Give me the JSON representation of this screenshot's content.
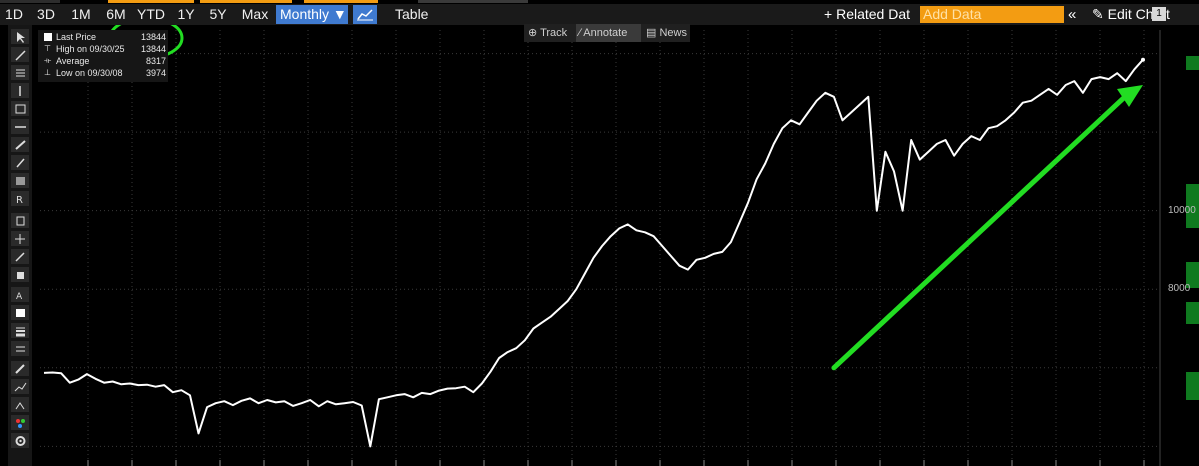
{
  "toolbar": {
    "range_buttons": [
      "1D",
      "3D",
      "1M",
      "6M",
      "YTD",
      "1Y",
      "5Y",
      "Max"
    ],
    "frequency": "Monthly",
    "table_label": "Table",
    "related_label": "Related Dat",
    "add_data_placeholder": "Add Data",
    "collapse_glyph": "«",
    "edit_chart_label": "Edit Chart",
    "badge_label": "1"
  },
  "chart_tabs": [
    "Track",
    "Annotate",
    "News"
  ],
  "legend": {
    "rows": [
      {
        "label": "Last Price",
        "value": "13844"
      },
      {
        "label": "High on 09/30/25",
        "value": "13844"
      },
      {
        "label": "Average",
        "value": "8317"
      },
      {
        "label": "Low on 09/30/08",
        "value": "3974"
      }
    ]
  },
  "colors": {
    "background": "#000000",
    "line": "#ffffff",
    "highlight": "#22dd22",
    "accent_blue": "#3f7ad0",
    "add_data_orange": "#f39c12"
  },
  "chart_data": {
    "type": "line",
    "series": [
      {
        "name": "Last Price",
        "values": [
          5870,
          5880,
          5860,
          5620,
          5700,
          5840,
          5720,
          5620,
          5650,
          5580,
          5600,
          5560,
          5570,
          5520,
          5560,
          5380,
          5430,
          5300,
          4330,
          5000,
          5100,
          5150,
          5050,
          5160,
          5220,
          5100,
          5180,
          5120,
          5150,
          5030,
          5100,
          5180,
          5020,
          5150,
          5070,
          5100,
          5130,
          5040,
          4000,
          5200,
          5250,
          5300,
          5330,
          5250,
          5360,
          5330,
          5420,
          5470,
          5480,
          5520,
          5380,
          5600,
          5900,
          6250,
          6400,
          6500,
          6700,
          7000,
          7150,
          7300,
          7500,
          7700,
          8000,
          8400,
          8800,
          9100,
          9350,
          9550,
          9650,
          9500,
          9450,
          9350,
          9100,
          8850,
          8600,
          8500,
          8750,
          8800,
          8900,
          8950,
          9200,
          9700,
          10200,
          10800,
          11200,
          11700,
          12100,
          12300,
          12200,
          12500,
          12800,
          13000,
          12900,
          12300,
          12500,
          12700,
          12900,
          10000,
          11500,
          11000,
          10000,
          11800,
          11300,
          11500,
          11700,
          11800,
          11400,
          11700,
          11900,
          11800,
          12100,
          12150,
          12300,
          12500,
          12750,
          12800,
          12950,
          13100,
          12950,
          13200,
          13300,
          13000,
          13350,
          13400,
          13350,
          13500,
          13300,
          13600,
          13844
        ]
      }
    ],
    "ylim": [
      3500,
      14600
    ],
    "ytick_labels": [
      "10000",
      "8000"
    ],
    "grid": true,
    "legend_position": "top-left",
    "annotations": [
      {
        "type": "arrow",
        "color": "#22dd22",
        "from_index": 92,
        "from_value": 6000,
        "to_index": 128,
        "to_value": 13200
      },
      {
        "type": "ellipse",
        "color": "#22dd22",
        "target": "legend-values"
      }
    ]
  }
}
